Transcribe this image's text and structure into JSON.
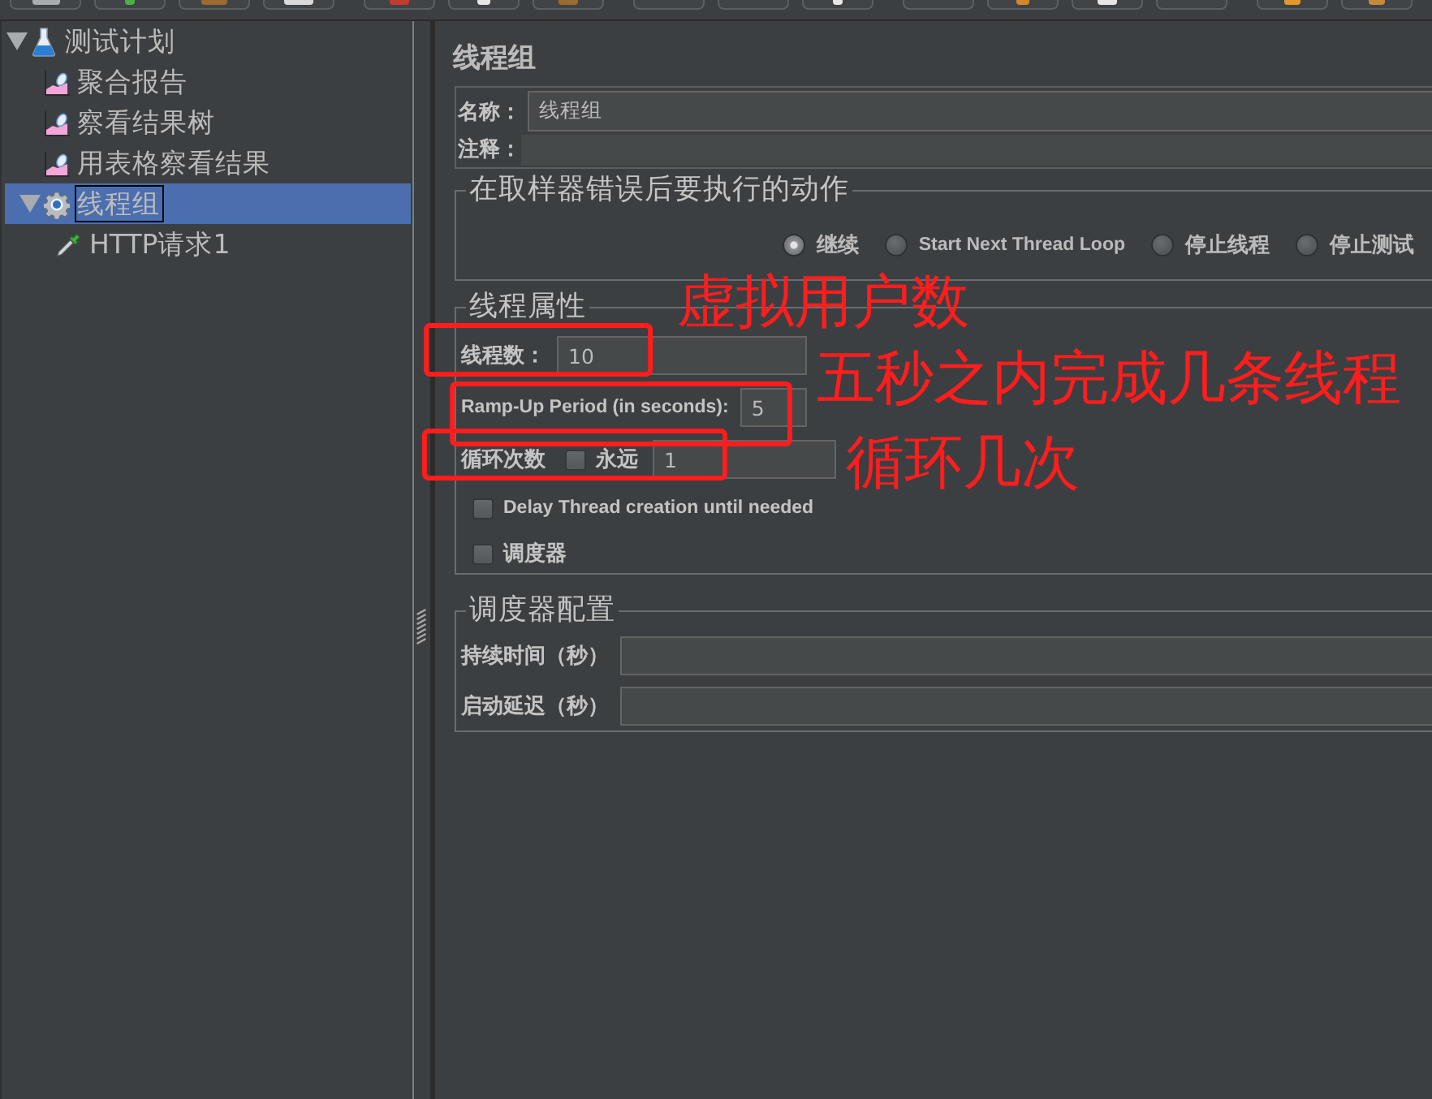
{
  "tree": [
    {
      "kind": "plan",
      "label": "测试计划",
      "expanded": true,
      "selected": false,
      "children": [
        {
          "kind": "listener",
          "label": "聚合报告",
          "selected": false
        },
        {
          "kind": "listener",
          "label": "察看结果树",
          "selected": false
        },
        {
          "kind": "listener",
          "label": "用表格察看结果",
          "selected": false
        },
        {
          "kind": "thread_group",
          "label": "线程组",
          "expanded": true,
          "selected": true,
          "children": [
            {
              "kind": "sampler",
              "label": "HTTP请求1",
              "selected": false
            }
          ]
        }
      ]
    }
  ],
  "editor": {
    "title": "线程组",
    "name": {
      "label": "名称：",
      "value": "线程组"
    },
    "comment": {
      "label": "注释："
    },
    "error_action": {
      "title": "在取样器错误后要执行的动作",
      "options": [
        {
          "label": "继续",
          "selected": true
        },
        {
          "label": "Start Next Thread Loop",
          "selected": false
        },
        {
          "label": "停止线程",
          "selected": false
        },
        {
          "label": "停止测试",
          "selected": false
        }
      ]
    },
    "thread_properties": {
      "title": "线程属性",
      "threads": {
        "label": "线程数：",
        "value": "10"
      },
      "ramp_up": {
        "label": "Ramp-Up Period (in seconds):",
        "value": "5"
      },
      "loop": {
        "label": "循环次数",
        "forever": {
          "label": "永远",
          "checked": false
        },
        "value": "1"
      },
      "options": [
        {
          "label": "Delay Thread creation until needed",
          "checked": false
        },
        {
          "label": "调度器",
          "checked": false
        }
      ]
    },
    "scheduler": {
      "title": "调度器配置",
      "fields": [
        {
          "label": "持续时间（秒）"
        },
        {
          "label": "启动延迟（秒）"
        }
      ]
    }
  },
  "annotations": [
    {
      "text": "虚拟用户数"
    },
    {
      "text": "五秒之内完成几条线程"
    },
    {
      "text": "循环几次"
    }
  ]
}
